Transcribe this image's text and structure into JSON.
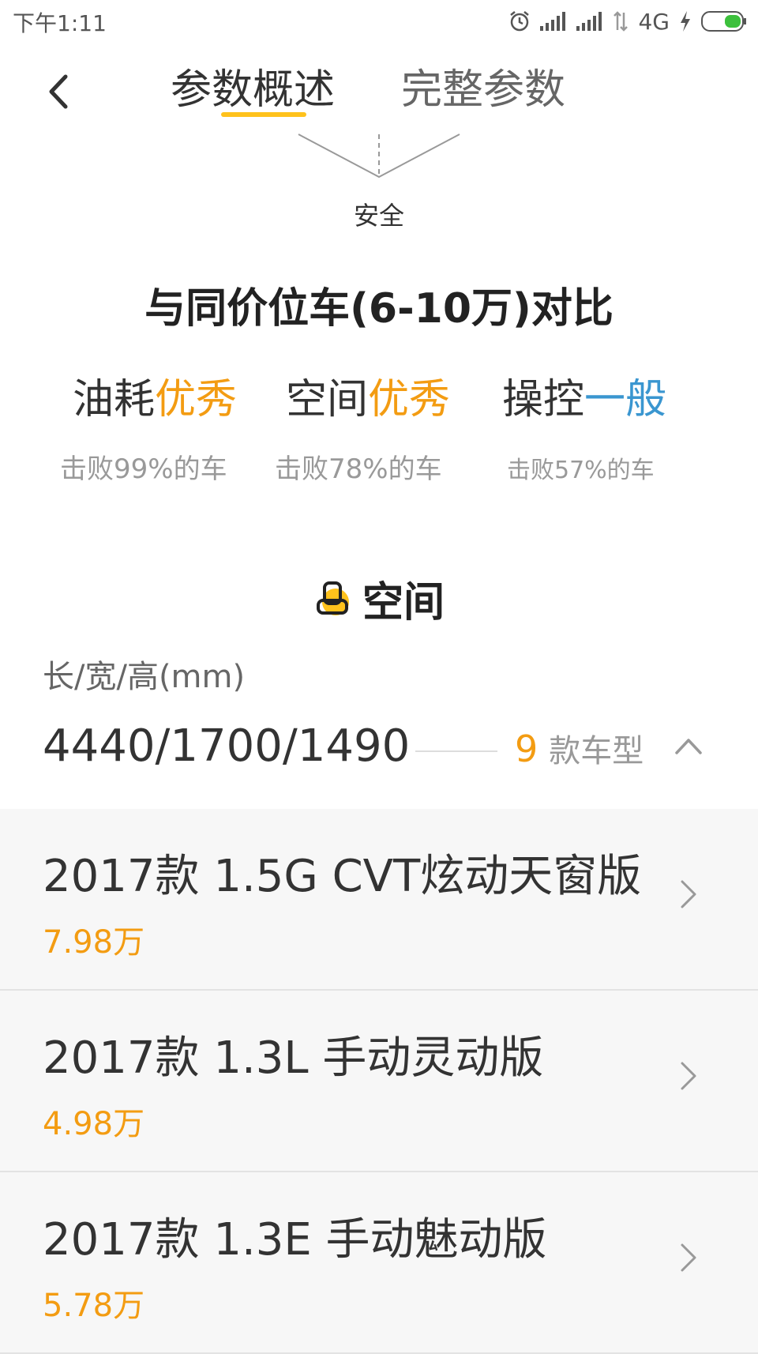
{
  "status_bar": {
    "time": "下午1:11",
    "network": "4G"
  },
  "header": {
    "tabs": [
      {
        "label": "参数概述",
        "active": true
      },
      {
        "label": "完整参数",
        "active": false
      }
    ]
  },
  "radar": {
    "label": "安全"
  },
  "comparison": {
    "title": "与同价位车(6-10万)对比",
    "metrics": [
      {
        "name": "油耗",
        "rating": "优秀",
        "beat": "击败99%的车"
      },
      {
        "name": "空间",
        "rating": "优秀",
        "beat": "击败78%的车"
      },
      {
        "name": "操控",
        "rating": "一般",
        "beat": "击败57%的车"
      }
    ]
  },
  "space": {
    "title": "空间",
    "dim_label": "长/宽/高(mm)",
    "dim_value": "4440/1700/1490",
    "model_count": "9",
    "model_count_suffix": "款车型"
  },
  "models": [
    {
      "name": "2017款 1.5G CVT炫动天窗版",
      "price": "7.98万"
    },
    {
      "name": "2017款 1.3L 手动灵动版",
      "price": "4.98万"
    },
    {
      "name": "2017款 1.3E 手动魅动版",
      "price": "5.78万"
    }
  ],
  "colors": {
    "accent": "#f39c12",
    "blue": "#3a96d0",
    "underline": "#ffc21c"
  }
}
